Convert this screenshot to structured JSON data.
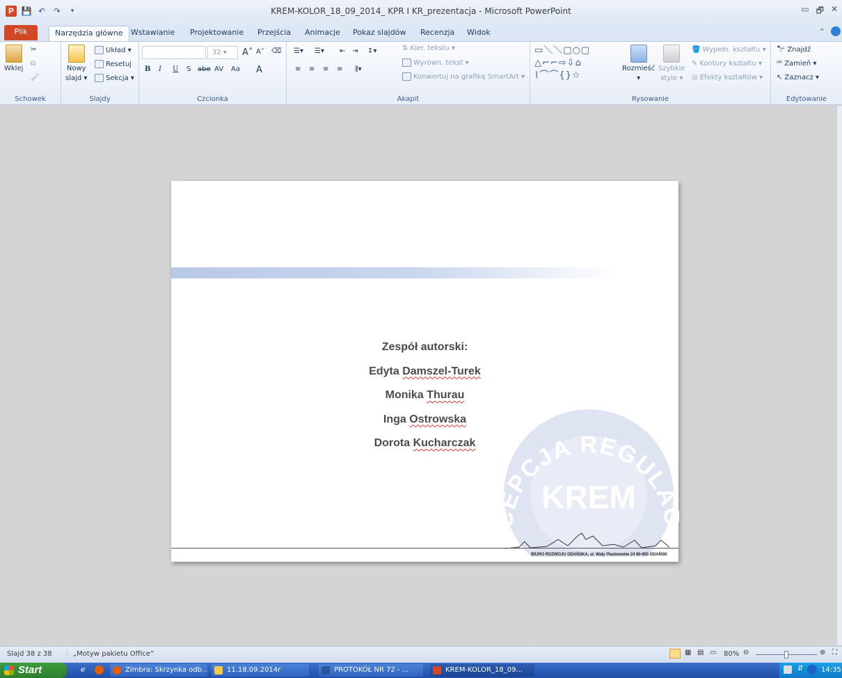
{
  "window": {
    "title": "KREM-KOLOR_18_09_2014_ KPR I KR_prezentacja  -  Microsoft PowerPoint",
    "qat_app_icon": "P",
    "min_glyph": "▭",
    "restore_glyph": "🗗",
    "close_glyph": "✕"
  },
  "tabs": [
    "Plik",
    "Narzędzia główne",
    "Wstawianie",
    "Projektowanie",
    "Przejścia",
    "Animacje",
    "Pokaz slajdów",
    "Recenzja",
    "Widok"
  ],
  "ribbon": {
    "clipboard": {
      "paste": "Wklej",
      "label": "Schowek"
    },
    "slides": {
      "new_slide_1": "Nowy",
      "new_slide_2": "slajd ▾",
      "layout": "Układ ▾",
      "reset": "Resetuj",
      "section": "Sekcja ▾",
      "label": "Slajdy"
    },
    "font": {
      "size": "32",
      "label": "Czcionka",
      "bold": "B",
      "italic": "I",
      "underline": "U",
      "strike": "S",
      "shadow": "abe",
      "spacing": "AV",
      "case": "Aa",
      "color": "A",
      "grow": "A˄",
      "shrink": "A˅"
    },
    "paragraph": {
      "direction": "Kier. tekstu ▾",
      "align": "Wyrówn. tekst ▾",
      "smartart": "Konwertuj na grafikę SmartArt ▾",
      "label": "Akapit"
    },
    "drawing": {
      "arrange": "Rozmieść",
      "quick_styles_1": "Szybkie",
      "quick_styles_2": "style ▾",
      "fill": "Wypełn. kształtu ▾",
      "outline": "Kontury kształtu ▾",
      "effects": "Efekty kształtów ▾",
      "label": "Rysowanie"
    },
    "editing": {
      "find": "Znajdź",
      "replace": "Zamień ▾",
      "select": "Zaznacz ▾",
      "label": "Edytowanie"
    }
  },
  "slide": {
    "heading": "Zespół autorski:",
    "authors": [
      {
        "first": "Edyta ",
        "last": "Damszel-Turek"
      },
      {
        "first": "Monika ",
        "last": "Thurau"
      },
      {
        "first": "Inga ",
        "last": "Ostrowska"
      },
      {
        "first": "Dorota ",
        "last": "Kucharczak"
      }
    ],
    "seal_text": "CEPCJA REGULACJI ESTETYCZNEJ",
    "seal_logo": "KREM",
    "footer": "BIURO ROZWOJU GDAŃSKA, ul. Wały Piastowskie 24  80-855 GDAŃSK"
  },
  "status": {
    "slide": "Slajd 38 z 38",
    "theme": "„Motyw pakietu Office”",
    "zoom": "80%",
    "zoom_level": 0.5
  },
  "taskbar": {
    "start": "Start",
    "items": [
      "Zimbra: Skrzynka odb...",
      "11.18.09.2014r",
      "PROTOKÓŁ NR  72 - ...",
      "KREM-KOLOR_18_09..."
    ],
    "clock": "14:35"
  },
  "colors": {
    "accent_file": "#d24726",
    "ribbon": "#e6edf7",
    "taskbar": "#2f64c2",
    "start": "#3c9e3c"
  }
}
